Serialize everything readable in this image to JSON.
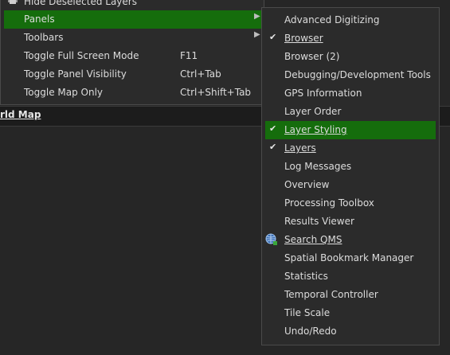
{
  "background": {
    "canvas_title": "rld Map"
  },
  "parent_menu": {
    "items": [
      {
        "label": "Hide Deselected Layers",
        "shortcut": "",
        "submenu": false,
        "partial": true
      },
      {
        "label": "Panels",
        "shortcut": "",
        "submenu": true,
        "highlighted": true
      },
      {
        "label": "Toolbars",
        "shortcut": "",
        "submenu": true
      },
      {
        "label": "Toggle Full Screen Mode",
        "shortcut": "F11",
        "submenu": false
      },
      {
        "label": "Toggle Panel Visibility",
        "shortcut": "Ctrl+Tab",
        "submenu": false
      },
      {
        "label": "Toggle Map Only",
        "shortcut": "Ctrl+Shift+Tab",
        "submenu": false
      }
    ],
    "arrow_glyph": "▶"
  },
  "panels_submenu": {
    "check_glyph": "✔",
    "items": [
      {
        "label": "Advanced Digitizing",
        "checked": false
      },
      {
        "label": "Browser",
        "checked": true
      },
      {
        "label": "Browser (2)",
        "checked": false
      },
      {
        "label": "Debugging/Development Tools",
        "checked": false
      },
      {
        "label": "GPS Information",
        "checked": false
      },
      {
        "label": "Layer Order",
        "checked": false
      },
      {
        "label": "Layer Styling",
        "checked": true,
        "highlighted": true
      },
      {
        "label": "Layers",
        "checked": true
      },
      {
        "label": "Log Messages",
        "checked": false
      },
      {
        "label": "Overview",
        "checked": false
      },
      {
        "label": "Processing Toolbox",
        "checked": false
      },
      {
        "label": "Results Viewer",
        "checked": false
      },
      {
        "label": "Search QMS",
        "checked": false,
        "icon": "globe-search-icon"
      },
      {
        "label": "Spatial Bookmark Manager",
        "checked": false
      },
      {
        "label": "Statistics",
        "checked": false
      },
      {
        "label": "Temporal Controller",
        "checked": false
      },
      {
        "label": "Tile Scale",
        "checked": false
      },
      {
        "label": "Undo/Redo",
        "checked": false
      }
    ]
  },
  "colors": {
    "highlight": "#156d0c",
    "menu_bg": "#2b2b2b",
    "text": "#dcdcdc"
  }
}
